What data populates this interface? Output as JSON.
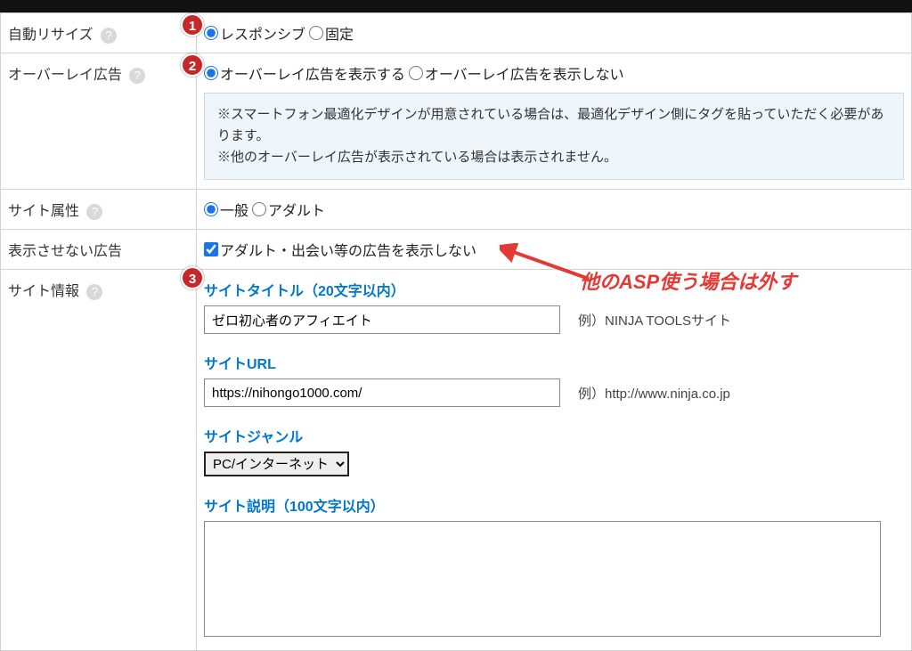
{
  "rows": {
    "auto_resize": {
      "label": "自動リサイズ",
      "option_responsive": "レスポンシブ",
      "option_fixed": "固定"
    },
    "overlay_ad": {
      "label": "オーバーレイ広告",
      "option_show": "オーバーレイ広告を表示する",
      "option_hide": "オーバーレイ広告を表示しない",
      "note_line1": "※スマートフォン最適化デザインが用意されている場合は、最適化デザイン側にタグを貼っていただく必要があります。",
      "note_line2": "※他のオーバーレイ広告が表示されている場合は表示されません。"
    },
    "site_attr": {
      "label": "サイト属性",
      "option_general": "一般",
      "option_adult": "アダルト"
    },
    "hide_ads": {
      "label": "表示させない広告",
      "checkbox_label": "アダルト・出会い等の広告を表示しない"
    },
    "site_info": {
      "label": "サイト情報",
      "title_label": "サイトタイトル（20文字以内）",
      "title_value": "ゼロ初心者のアフィエイト",
      "title_example": "例）NINJA TOOLSサイト",
      "url_label": "サイトURL",
      "url_value": "https://nihongo1000.com/",
      "url_example": "例）http://www.ninja.co.jp",
      "genre_label": "サイトジャンル",
      "genre_value": "PC/インターネット",
      "desc_label": "サイト説明（100文字以内）",
      "desc_value": ""
    }
  },
  "badges": {
    "b1": "1",
    "b2": "2",
    "b3": "3"
  },
  "annotation": "他のASP使う場合は外す",
  "help_glyph": "?"
}
